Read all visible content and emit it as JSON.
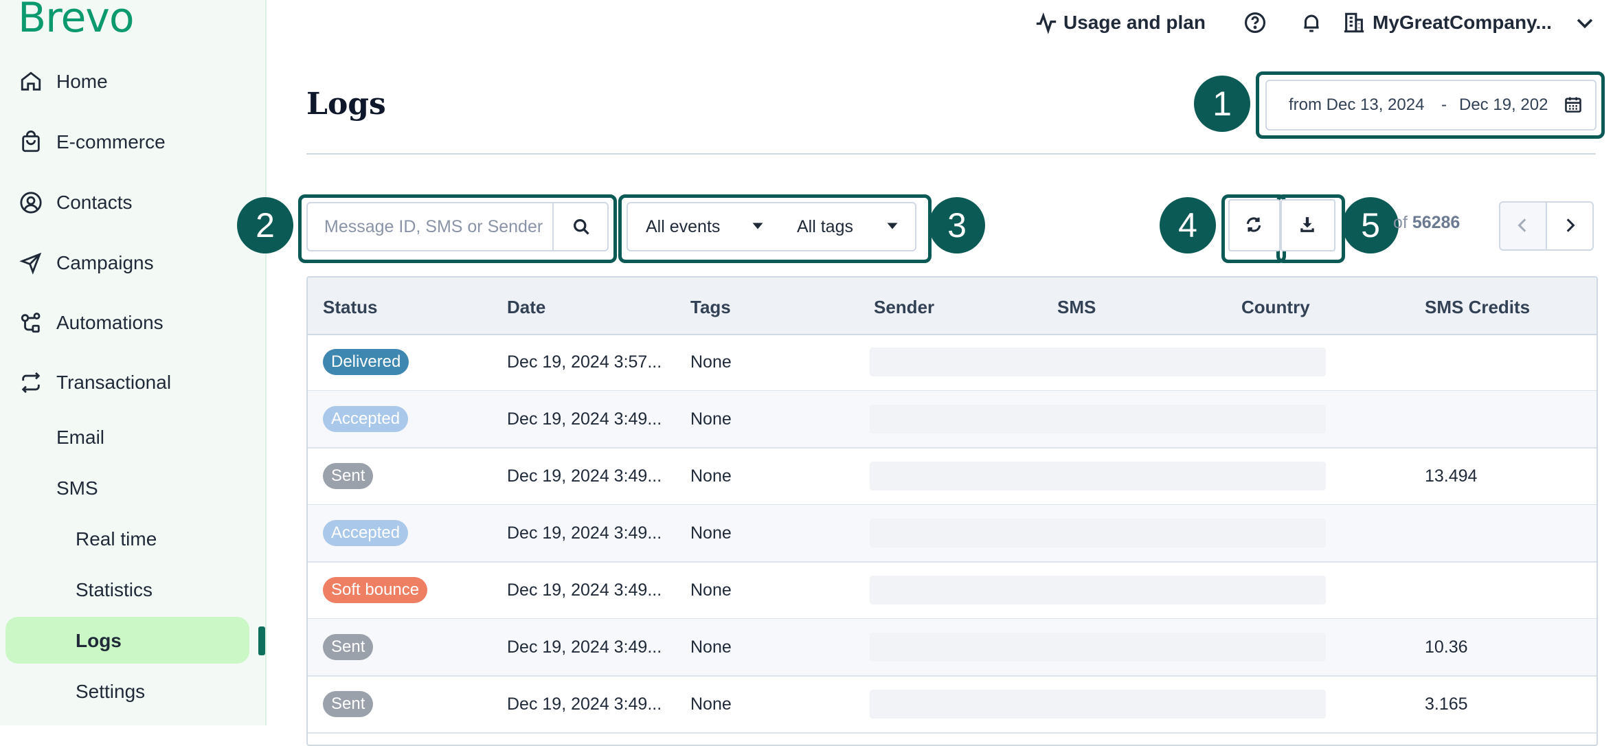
{
  "app": {
    "logo": "Brevo"
  },
  "topbar": {
    "usage_label": "Usage and plan",
    "company_label": "MyGreatCompany..."
  },
  "sidebar": {
    "items": [
      {
        "label": "Home",
        "icon": "home-icon"
      },
      {
        "label": "E-commerce",
        "icon": "shopping-bag-icon"
      },
      {
        "label": "Contacts",
        "icon": "contacts-icon"
      },
      {
        "label": "Campaigns",
        "icon": "send-icon"
      },
      {
        "label": "Automations",
        "icon": "automations-icon"
      },
      {
        "label": "Transactional",
        "icon": "transactional-icon"
      }
    ],
    "sub_items": [
      "Email",
      "SMS"
    ],
    "sms_items": [
      "Real time",
      "Statistics",
      "Logs",
      "Settings"
    ],
    "active": "Logs"
  },
  "page": {
    "title": "Logs"
  },
  "date_range": {
    "from_text": "from Dec 13, 2024",
    "separator": "-",
    "to_text": "Dec 19, 202"
  },
  "search": {
    "placeholder": "Message ID, SMS or Sender"
  },
  "filters": {
    "events": "All events",
    "tags": "All tags"
  },
  "pager": {
    "of_label": "of",
    "total": "56286"
  },
  "annotations": [
    "1",
    "2",
    "3",
    "4",
    "5"
  ],
  "table": {
    "columns": [
      "Status",
      "Date",
      "Tags",
      "Sender",
      "SMS",
      "Country",
      "SMS Credits"
    ],
    "rows": [
      {
        "status": "Delivered",
        "status_color": "#3d87b0",
        "date": "Dec 19, 2024 3:57...",
        "tags": "None",
        "credits": ""
      },
      {
        "status": "Accepted",
        "status_color": "#a9c8ea",
        "date": "Dec 19, 2024 3:49...",
        "tags": "None",
        "credits": ""
      },
      {
        "status": "Sent",
        "status_color": "#9aa1ab",
        "date": "Dec 19, 2024 3:49...",
        "tags": "None",
        "credits": "13.494"
      },
      {
        "status": "Accepted",
        "status_color": "#a9c8ea",
        "date": "Dec 19, 2024 3:49...",
        "tags": "None",
        "credits": ""
      },
      {
        "status": "Soft bounce",
        "status_color": "#ee7f62",
        "date": "Dec 19, 2024 3:49...",
        "tags": "None",
        "credits": ""
      },
      {
        "status": "Sent",
        "status_color": "#9aa1ab",
        "date": "Dec 19, 2024 3:49...",
        "tags": "None",
        "credits": "10.36"
      },
      {
        "status": "Sent",
        "status_color": "#9aa1ab",
        "date": "Dec 19, 2024 3:49...",
        "tags": "None",
        "credits": "3.165"
      }
    ]
  },
  "colors": {
    "accent": "#0b996e",
    "annotation": "#0c5a55",
    "active_bg": "#cbf7c7"
  }
}
